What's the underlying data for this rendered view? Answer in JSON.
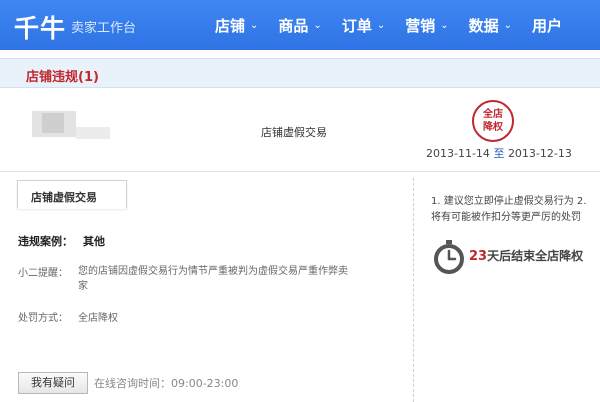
{
  "header": {
    "logo": "千牛",
    "subtitle": "卖家工作台",
    "nav": [
      {
        "label": "店铺"
      },
      {
        "label": "商品"
      },
      {
        "label": "订单"
      },
      {
        "label": "营销"
      },
      {
        "label": "数据"
      },
      {
        "label": "用户"
      }
    ]
  },
  "section": {
    "title": "店铺违规(1)"
  },
  "record": {
    "violation_type": "店铺虚假交易",
    "seal_line1": "全店",
    "seal_line2": "降权",
    "date_start": "2013-11-14",
    "date_to": "至",
    "date_end": "2013-12-13"
  },
  "detail": {
    "tab": "店铺虚假交易",
    "case_label": "违规案例：",
    "case_value": "其他",
    "reminder_label": "小二提醒：",
    "reminder_text": "您的店铺因虚假交易行为情节严重被判为虚假交易严重作弊卖家",
    "penalty_label": "处罚方式：",
    "penalty_value": "全店降权",
    "ask_button": "我有疑问",
    "hours": "在线咨询时间：09:00-23:00"
  },
  "advice": {
    "line1": "1. 建议您立即停止虚假交易行为 2.",
    "line2": "将有可能被作扣分等更严厉的处罚",
    "countdown_num": "23",
    "countdown_text": "天后结束全店降权"
  },
  "colors": {
    "header": "#3f86f2",
    "accent_red": "#c1272d",
    "section_bg": "#e9f1fb"
  }
}
